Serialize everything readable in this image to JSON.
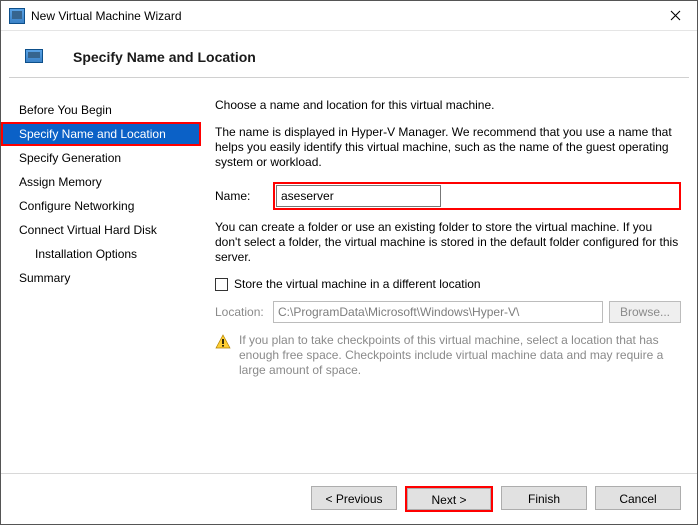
{
  "titlebar": {
    "text": "New Virtual Machine Wizard"
  },
  "header": {
    "title": "Specify Name and Location"
  },
  "sidebar": {
    "items": [
      "Before You Begin",
      "Specify Name and Location",
      "Specify Generation",
      "Assign Memory",
      "Configure Networking",
      "Connect Virtual Hard Disk",
      "Installation Options",
      "Summary"
    ]
  },
  "content": {
    "p1": "Choose a name and location for this virtual machine.",
    "p2": "The name is displayed in Hyper-V Manager. We recommend that you use a name that helps you easily identify this virtual machine, such as the name of the guest operating system or workload.",
    "name_label": "Name:",
    "name_value": "aseserver",
    "p3": "You can create a folder or use an existing folder to store the virtual machine. If you don't select a folder, the virtual machine is stored in the default folder configured for this server.",
    "checkbox_label": "Store the virtual machine in a different location",
    "location_label": "Location:",
    "location_value": "C:\\ProgramData\\Microsoft\\Windows\\Hyper-V\\",
    "browse_label": "Browse...",
    "warning": "If you plan to take checkpoints of this virtual machine, select a location that has enough free space. Checkpoints include virtual machine data and may require a large amount of space."
  },
  "footer": {
    "previous": "< Previous",
    "next": "Next >",
    "finish": "Finish",
    "cancel": "Cancel"
  }
}
